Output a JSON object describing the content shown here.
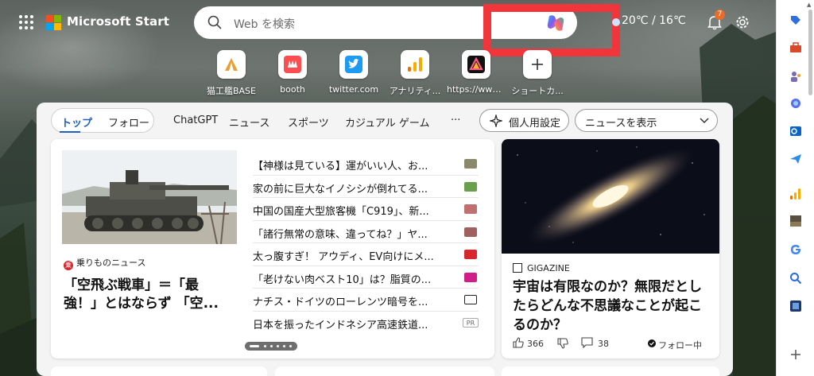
{
  "topbar": {
    "brand": "Microsoft Start",
    "search_placeholder": "Web を検索",
    "weather": "20℃ / 16℃",
    "notification_count": "7"
  },
  "quick_links": [
    {
      "label": "猫工艦BASE",
      "icon": "triangle-tent-icon"
    },
    {
      "label": "booth",
      "icon": "booth-icon"
    },
    {
      "label": "twitter.com",
      "icon": "twitter-bird-icon"
    },
    {
      "label": "アナリティ...",
      "icon": "analytics-bars-icon"
    },
    {
      "label": "https://www....",
      "icon": "triangle-logo-icon"
    },
    {
      "label": "ショートカ...",
      "icon": "plus-icon"
    }
  ],
  "nav": {
    "tabs": [
      "トップ",
      "フォロー"
    ],
    "categories": [
      "ChatGPT",
      "ニュース",
      "スポーツ",
      "カジュアル ゲーム"
    ],
    "more": "···",
    "personalize_label": "個人用設定",
    "show_news_label": "ニュースを表示"
  },
  "feature": {
    "source": "乗りものニュース",
    "source_logo_text": "乗",
    "headline": "「空飛ぶ戦車」＝「最強！」とはならず 「空..."
  },
  "news_list": [
    {
      "text": "【神様は見ている】運がいい人、お...",
      "pub_color": "#8a8a6a"
    },
    {
      "text": "家の前に巨大なイノシシが倒れてる...",
      "pub_color": "#6aa04a"
    },
    {
      "text": "中国の国産大型旅客機「C919」、新...",
      "pub_color": "#c07070"
    },
    {
      "text": "「諸行無常の意味、違ってね？」ヤ...",
      "pub_color": "#a06060"
    },
    {
      "text": "太っ腹すぎ！ アウディ、EV向けにメ...",
      "pub_color": "#d8262e"
    },
    {
      "text": "「老けない肉ベスト10」は？脂質の...",
      "pub_color": "#d01f8a"
    },
    {
      "text": "ナチス・ドイツのローレンツ暗号を...",
      "pub_color": "#222222"
    },
    {
      "text": "日本を振ったインドネシア高速鉄道...",
      "pub_color": "#888888",
      "pub_text": "PR"
    }
  ],
  "right_card": {
    "source": "GIGAZINE",
    "headline": "宇宙は有限なのか？無限だとしたらどんな不思議なことが起こるのか？",
    "likes": "366",
    "comments": "38",
    "follow_label": "フォロー中"
  },
  "colors": {
    "highlight": "#f0353b",
    "accent": "#1f5fbf"
  }
}
